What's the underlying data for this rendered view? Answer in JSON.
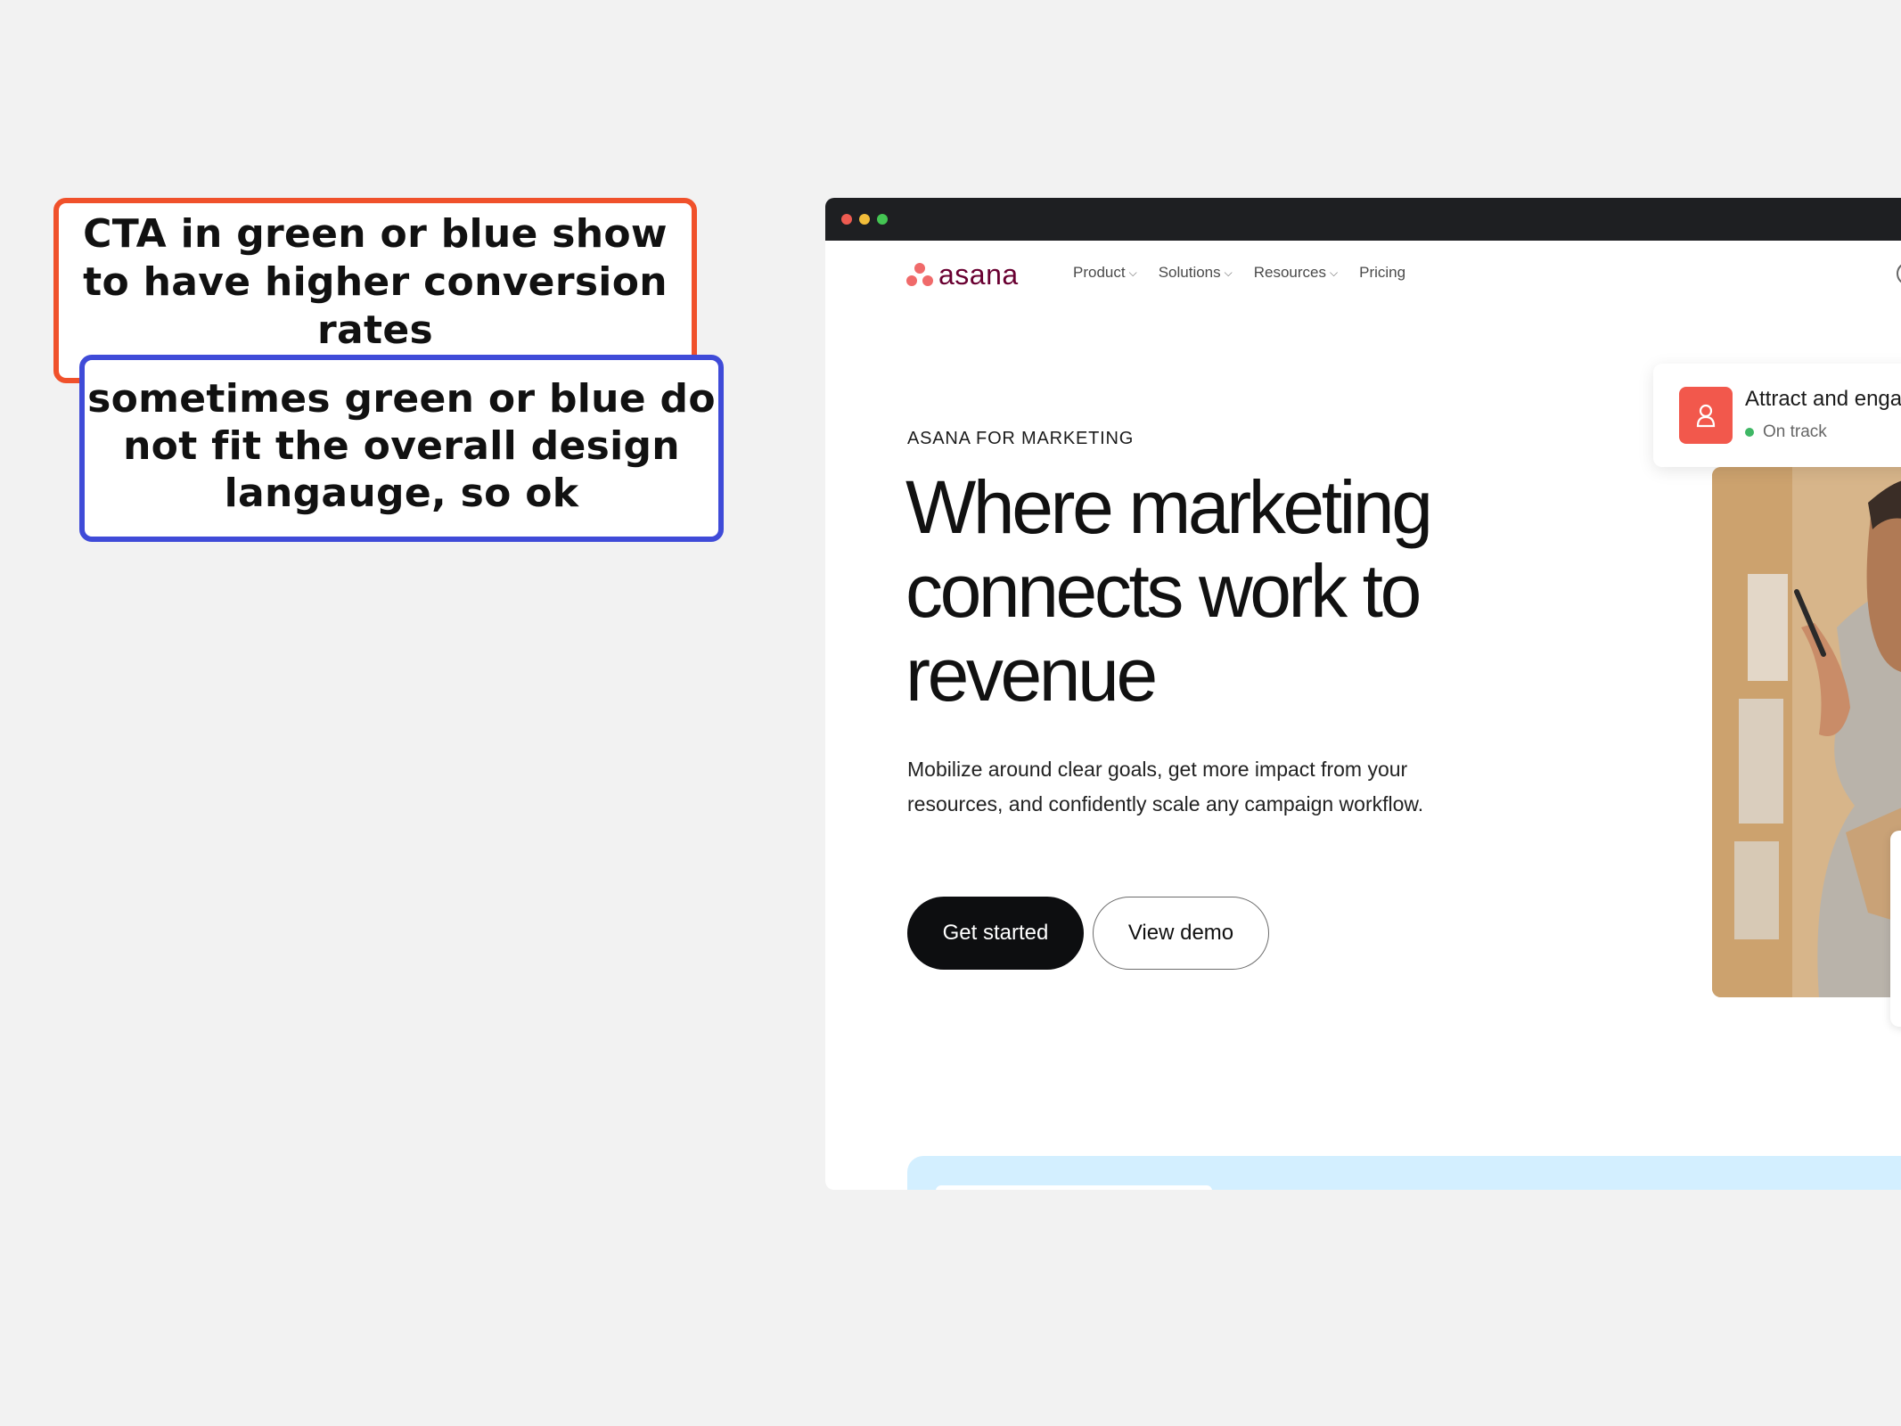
{
  "annotations": {
    "red_note": "CTA in green or blue show to have higher conversion rates",
    "blue_note": "sometimes green or blue do not fit the overall design langauge, so ok"
  },
  "browser": {
    "logo_text": "asana",
    "nav": {
      "product": "Product",
      "solutions": "Solutions",
      "resources": "Resources",
      "pricing": "Pricing"
    },
    "hero": {
      "eyebrow": "ASANA FOR MARKETING",
      "headline": "Where marketing connects work to revenue",
      "subcopy": "Mobilize around clear goals, get more impact from your resources, and confidently scale any campaign workflow.",
      "primary_cta": "Get started",
      "secondary_cta": "View demo"
    },
    "status_card": {
      "title": "Attract and enga",
      "status": "On track"
    }
  },
  "colors": {
    "red_note_border": "#f0512b",
    "blue_note_border": "#3f4bd8",
    "primary_cta_bg": "#0d0e10",
    "asana_coral": "#f06a6a",
    "status_green": "#3fb765"
  },
  "icons": {
    "status_icon": "person-icon",
    "globe_icon": "globe-icon"
  }
}
